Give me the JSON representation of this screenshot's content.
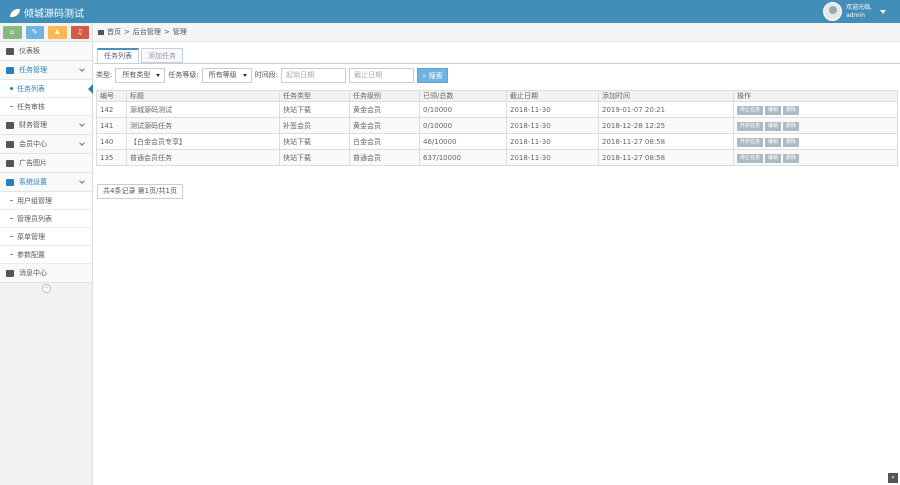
{
  "app": {
    "title": "倾城源码测试"
  },
  "user": {
    "greeting": "欢迎光临,",
    "name": "admin"
  },
  "shortcuts": [
    {
      "icon": "home-icon",
      "color": "#87b87f"
    },
    {
      "icon": "pencil-icon",
      "color": "#6fb3e0"
    },
    {
      "icon": "users-icon",
      "color": "#ffb752"
    },
    {
      "icon": "bell-icon",
      "color": "#d15b47"
    }
  ],
  "sidebar": {
    "dashboard": "仪表板",
    "tasks": "任务管理",
    "task_list": "任务列表",
    "task_review": "任务审核",
    "finance": "财务管理",
    "members": "会员中心",
    "ads": "广告图片",
    "settings": "系统设置",
    "user_list": "用户组管理",
    "admin_list": "管理员列表",
    "menu_mgmt": "菜单管理",
    "params": "参数配置",
    "message_center": "消息中心"
  },
  "breadcrumb": {
    "home": "首页",
    "sep1": ">",
    "backend": "后台管理",
    "sep2": ">",
    "current": "管理"
  },
  "tabs": {
    "list": "任务列表",
    "add": "添加任务"
  },
  "filters": {
    "type_label": "类型:",
    "type_value": "所有类型",
    "level_label": "任务等级:",
    "level_value": "所有等级",
    "time_label": "时间段:",
    "start_placeholder": "起始日期",
    "end_placeholder": "截止日期",
    "search_button": "搜索"
  },
  "table": {
    "headers": [
      "编号",
      "标题",
      "任务类型",
      "任务级别",
      "已领/总数",
      "截止日期",
      "添加时间",
      "操作"
    ],
    "rows": [
      {
        "id": "142",
        "title": "源城源码测试",
        "type": "快站下载",
        "level": "黄金会员",
        "count": "0/10000",
        "deadline": "2018-11-30",
        "added": "2019-01-07 20:21",
        "ops": [
          "停止任务",
          "编辑",
          "删除"
        ]
      },
      {
        "id": "141",
        "title": "测试源码任务",
        "type": "补签会员",
        "level": "黄金会员",
        "count": "0/10000",
        "deadline": "2018-11-30",
        "added": "2018-12-28 12:25",
        "ops": [
          "开启任务",
          "编辑",
          "删除"
        ]
      },
      {
        "id": "140",
        "title": "【白金会员专享】",
        "type": "快站下载",
        "level": "白金会员",
        "count": "46/10000",
        "deadline": "2018-11-30",
        "added": "2018-11-27 08:58",
        "ops": [
          "开启任务",
          "编辑",
          "删除"
        ]
      },
      {
        "id": "135",
        "title": "普通会员任务",
        "type": "快站下载",
        "level": "普通会员",
        "count": "637/10000",
        "deadline": "2018-11-30",
        "added": "2018-11-27 08:58",
        "ops": [
          "停止任务",
          "编辑",
          "删除"
        ]
      }
    ]
  },
  "pagination": "共4条记录 第1页/共1页"
}
